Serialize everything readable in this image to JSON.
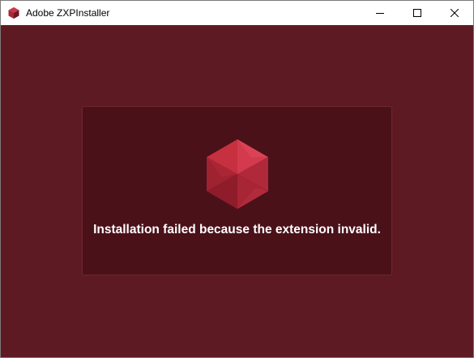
{
  "window": {
    "title": "Adobe ZXPInstaller",
    "app_icon": "zxpinstaller-cube-icon",
    "controls": {
      "minimize_icon": "minimize-icon",
      "maximize_icon": "maximize-icon",
      "close_icon": "close-icon"
    }
  },
  "main": {
    "status_icon": "red-cube-icon",
    "message": "Installation failed because the extension invalid."
  },
  "colors": {
    "background": "#5e1a22",
    "panel": "#4a1119",
    "panel_border": "#6f2630",
    "cube_accent": "#c42b3e",
    "text": "#ffffff"
  }
}
